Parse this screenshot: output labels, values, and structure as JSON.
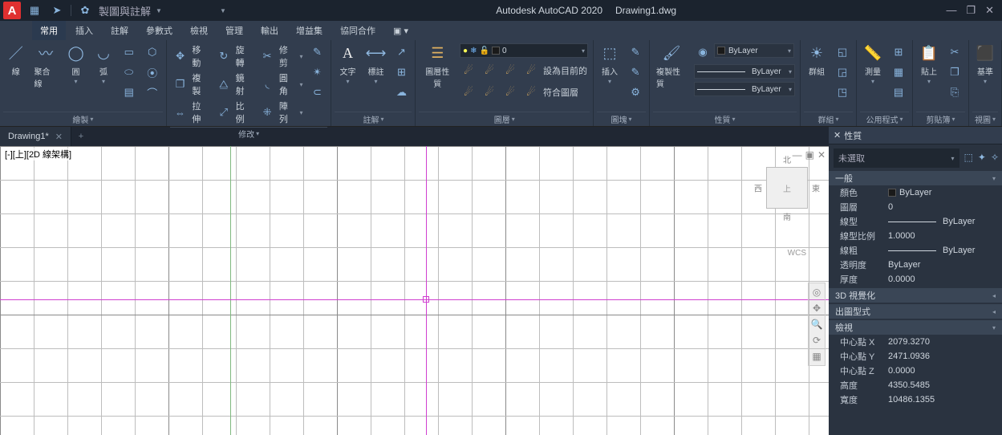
{
  "title": {
    "app": "Autodesk AutoCAD 2020",
    "doc": "Drawing1.dwg"
  },
  "qat_label": "製圖與註解",
  "menu": {
    "active": "常用",
    "items": [
      "常用",
      "插入",
      "註解",
      "參數式",
      "檢視",
      "管理",
      "輸出",
      "增益集",
      "協同合作"
    ]
  },
  "ribbon": {
    "draw": {
      "line": "線",
      "polyline": "聚合線",
      "circle": "圓",
      "arc": "弧",
      "label": "繪製"
    },
    "modify": {
      "move": "移動",
      "rotate": "旋轉",
      "trim": "修剪",
      "copy": "複製",
      "mirror": "鏡射",
      "fillet": "圓角",
      "stretch": "拉伸",
      "scale": "比例",
      "array": "陣列",
      "label": "修改"
    },
    "annot": {
      "text": "文字",
      "dim": "標註",
      "table": "表格",
      "label": "註解"
    },
    "layer": {
      "props": "圖層性質",
      "current": "0",
      "setcurrent": "設為目前的",
      "match": "符合圖層",
      "label": "圖層"
    },
    "block": {
      "insert": "插入",
      "label": "圖塊"
    },
    "props": {
      "matchprop": "複製性質",
      "bylayer": "ByLayer",
      "label": "性質"
    },
    "group": {
      "group": "群組",
      "label": "群組"
    },
    "util": {
      "measure": "測量",
      "label": "公用程式"
    },
    "clip": {
      "paste": "貼上",
      "label": "剪貼簿"
    },
    "view": {
      "base": "基準",
      "label": "視圖"
    }
  },
  "tabs": {
    "active": "Drawing1*"
  },
  "viewport": {
    "label": "[-][上][2D 線架構]",
    "wcs": "WCS",
    "north": "北",
    "south": "南",
    "east": "東",
    "west": "西",
    "top": "上"
  },
  "palette": {
    "title": "性質",
    "nosel": "未選取",
    "sections": {
      "general": "一般",
      "visual3d": "3D 視覺化",
      "plotstyle": "出圖型式",
      "view": "檢視"
    },
    "rows": {
      "color": {
        "k": "顏色",
        "v": "ByLayer"
      },
      "layer": {
        "k": "圖層",
        "v": "0"
      },
      "ltype": {
        "k": "線型",
        "v": "ByLayer"
      },
      "ltscale": {
        "k": "線型比例",
        "v": "1.0000"
      },
      "lweight": {
        "k": "線粗",
        "v": "ByLayer"
      },
      "trans": {
        "k": "透明度",
        "v": "ByLayer"
      },
      "thick": {
        "k": "厚度",
        "v": "0.0000"
      },
      "cx": {
        "k": "中心點 X",
        "v": "2079.3270"
      },
      "cy": {
        "k": "中心點 Y",
        "v": "2471.0936"
      },
      "cz": {
        "k": "中心點 Z",
        "v": "0.0000"
      },
      "h": {
        "k": "高度",
        "v": "4350.5485"
      },
      "w": {
        "k": "寬度",
        "v": "10486.1355"
      }
    }
  }
}
